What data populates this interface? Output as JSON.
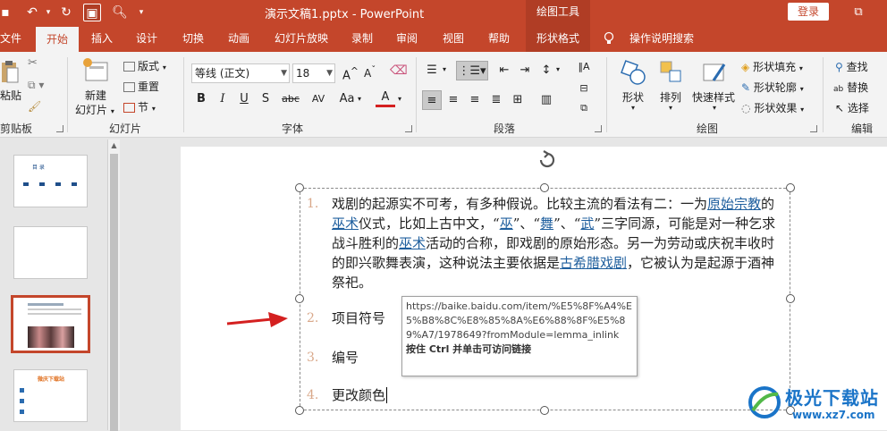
{
  "titlebar": {
    "title": "演示文稿1.pptx - PowerPoint",
    "context_tab_group": "绘图工具",
    "login": "登录"
  },
  "tabs": [
    {
      "label": "文件"
    },
    {
      "label": "开始"
    },
    {
      "label": "插入"
    },
    {
      "label": "设计"
    },
    {
      "label": "切换"
    },
    {
      "label": "动画"
    },
    {
      "label": "幻灯片放映"
    },
    {
      "label": "录制"
    },
    {
      "label": "审阅"
    },
    {
      "label": "视图"
    },
    {
      "label": "帮助"
    },
    {
      "label": "形状格式"
    },
    {
      "label": "操作说明搜索"
    }
  ],
  "ribbon": {
    "clipboard": {
      "paste": "粘贴",
      "group": "剪贴板"
    },
    "slides": {
      "new_slide": "新建",
      "new_slide2": "幻灯片",
      "layout": "版式",
      "reset": "重置",
      "section": "节",
      "group": "幻灯片"
    },
    "font": {
      "font_name": "等线 (正文)",
      "font_size": "18",
      "group": "字体",
      "b": "B",
      "i": "I",
      "u": "U",
      "s": "S",
      "abc": "abc",
      "av": "AV",
      "aa": "Aa",
      "a_color": "A"
    },
    "paragraph": {
      "group": "段落"
    },
    "drawing": {
      "shapes": "形状",
      "arrange": "排列",
      "quick_styles": "快速样式",
      "fill": "形状填充",
      "outline": "形状轮廓",
      "effects": "形状效果",
      "group": "绘图"
    },
    "editing": {
      "find": "查找",
      "replace": "替换",
      "select": "选择",
      "group": "编辑"
    }
  },
  "slide": {
    "items": [
      {
        "num": "1.",
        "parts": [
          {
            "t": "戏剧的起源实不可考，有多种假说。比较主流的看法有二：一为"
          },
          {
            "t": "原始宗教",
            "link": true
          },
          {
            "t": "的"
          },
          {
            "t": "巫术",
            "link": true
          },
          {
            "t": "仪式，比如上古中文，“"
          },
          {
            "t": "巫",
            "link": true
          },
          {
            "t": "”、“"
          },
          {
            "t": "舞",
            "link": true
          },
          {
            "t": "”、“"
          },
          {
            "t": "武",
            "link": true
          },
          {
            "t": "”三字同源，可能是对一种乞求战斗胜利的"
          },
          {
            "t": "巫术",
            "link": true
          },
          {
            "t": "活动的合称，即戏剧的原始形态。另一为劳动或庆祝丰收时的即兴歌舞表演，这种说法主要依据是"
          },
          {
            "t": "古希腊戏剧",
            "link": true
          },
          {
            "t": "，它被认为是起源于酒神祭祀。"
          }
        ]
      },
      {
        "num": "2.",
        "text": "项目符号"
      },
      {
        "num": "3.",
        "text": "编号"
      },
      {
        "num": "4.",
        "text": "更改颜色"
      }
    ],
    "tooltip": {
      "url": "https://baike.baidu.com/item/%E5%8F%A4%E5%B8%8C%E8%85%8A%E6%88%8F%E5%89%A7/1978649?fromModule=lemma_inlink",
      "hint": "按住 Ctrl 并单击可访问链接"
    }
  },
  "thumbnails": [
    {
      "title": "目  录",
      "selected": false
    },
    {
      "title": "",
      "selected": false
    },
    {
      "title": "",
      "selected": true
    },
    {
      "title": "微庆下载站",
      "selected": false
    }
  ],
  "watermark": {
    "name": "极光下载站",
    "url": "www.xz7.com"
  },
  "colors": {
    "accent": "#c4462b",
    "link": "#1f5f9e",
    "number": "#d9a88a",
    "arrow": "#d42020"
  }
}
